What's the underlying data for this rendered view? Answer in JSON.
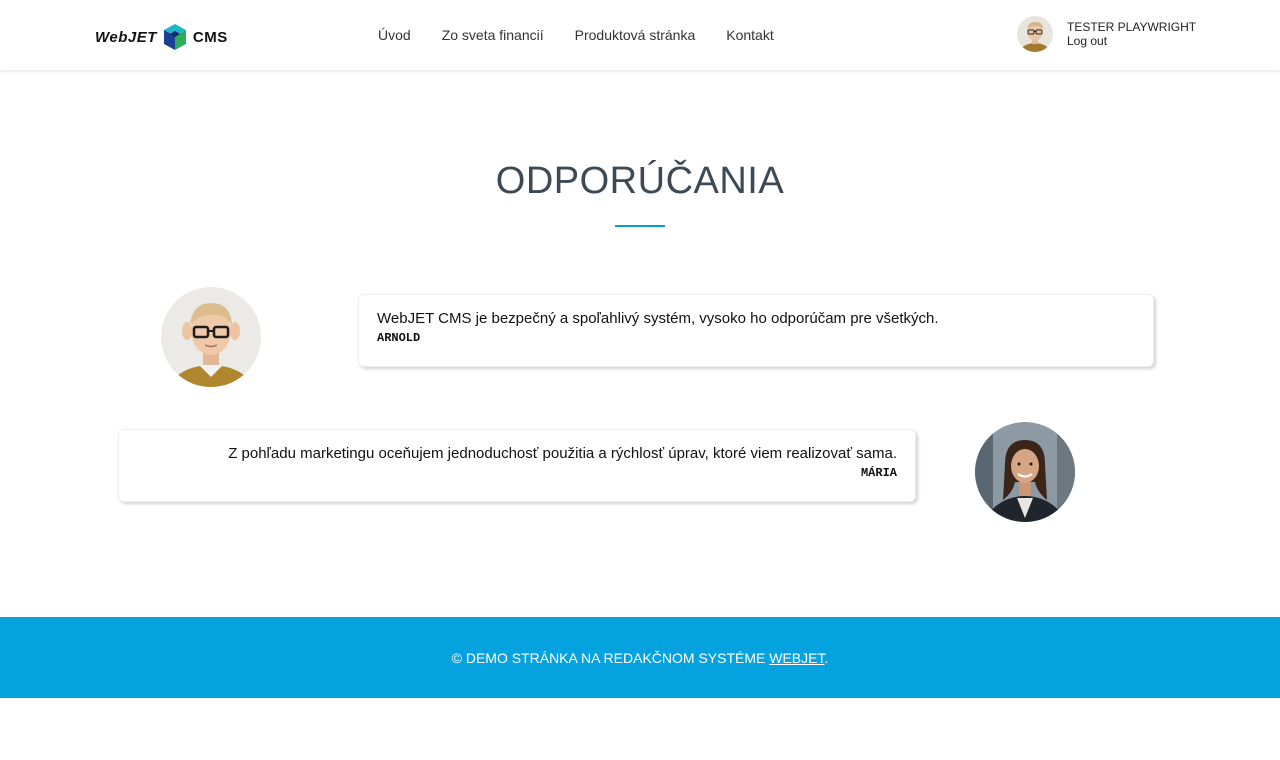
{
  "header": {
    "logo": {
      "left_text": "WebJET",
      "right_text": "CMS"
    },
    "nav": [
      "Úvod",
      "Zo sveta financií",
      "Produktová stránka",
      "Kontakt"
    ],
    "user": {
      "name": "TESTER PLAYWRIGHT",
      "logout_label": "Log out"
    }
  },
  "main": {
    "title": "ODPORÚČANIA",
    "testimonials": [
      {
        "quote": "WebJET CMS je bezpečný a spoľahlivý systém, vysoko ho odporúčam pre všetkých.",
        "author": "ARNOLD"
      },
      {
        "quote": "Z pohľadu marketingu oceňujem jednoduchosť použitia a rýchlosť úprav, ktoré viem realizovať sama.",
        "author": "MÁRIA"
      }
    ]
  },
  "footer": {
    "text": "© DEMO STRÁNKA NA REDAKČNOM SYSTÉME ",
    "link_label": "WEBJET",
    "suffix": "."
  },
  "colors": {
    "accent": "#0a9ad6",
    "footer_bg": "#04a3e0",
    "title": "#3d4a55"
  }
}
